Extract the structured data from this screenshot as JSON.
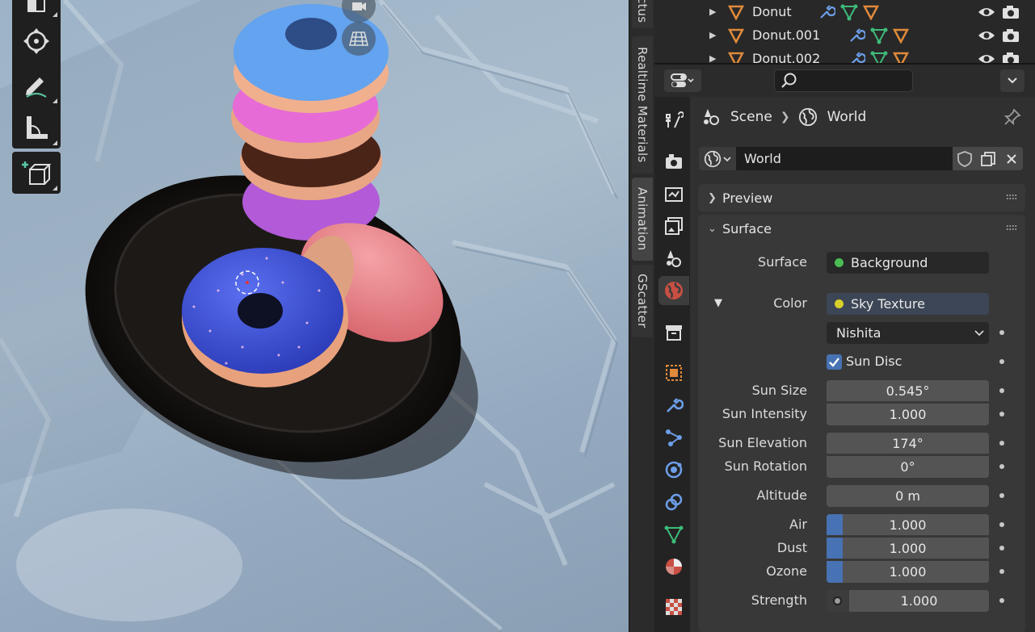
{
  "viewport": {
    "tools": [
      "transform-tool",
      "annotate-tool",
      "measure-tool",
      "add-cube-tool"
    ]
  },
  "npanel": {
    "tabs": [
      {
        "label": "ctus",
        "active": false
      },
      {
        "label": "Realtime Materials",
        "active": false
      },
      {
        "label": "Animation",
        "active": true
      },
      {
        "label": "GScatter",
        "active": false
      }
    ]
  },
  "outliner": {
    "rows": [
      {
        "name": "Donut"
      },
      {
        "name": "Donut.001"
      },
      {
        "name": "Donut.002"
      }
    ]
  },
  "properties": {
    "breadcrumb": {
      "scene": "Scene",
      "world": "World"
    },
    "world_name": "World",
    "panels": {
      "preview": {
        "title": "Preview",
        "expanded": false
      },
      "surface": {
        "title": "Surface",
        "expanded": true
      }
    },
    "surface": {
      "surface_label": "Surface",
      "surface_value": "Background",
      "color_label": "Color",
      "color_value": "Sky Texture",
      "sky_type": "Nishita",
      "sun_disc_label": "Sun Disc",
      "sun_disc_checked": true,
      "rows": [
        {
          "label": "Sun Size",
          "value": "0.545°"
        },
        {
          "label": "Sun Intensity",
          "value": "1.000"
        },
        {
          "label": "Sun Elevation",
          "value": "174°"
        },
        {
          "label": "Sun Rotation",
          "value": "0°"
        },
        {
          "label": "Altitude",
          "value": "0 m"
        },
        {
          "label": "Air",
          "value": "1.000",
          "fill": 0.1
        },
        {
          "label": "Dust",
          "value": "1.000",
          "fill": 0.1
        },
        {
          "label": "Ozone",
          "value": "1.000",
          "fill": 0.1
        },
        {
          "label": "Strength",
          "value": "1.000"
        }
      ]
    }
  },
  "colors": {
    "accent_blue": "#4772b3",
    "socket_green": "#4bbd54",
    "socket_yellow": "#d8d02a",
    "object_orange": "#e08a3b"
  }
}
